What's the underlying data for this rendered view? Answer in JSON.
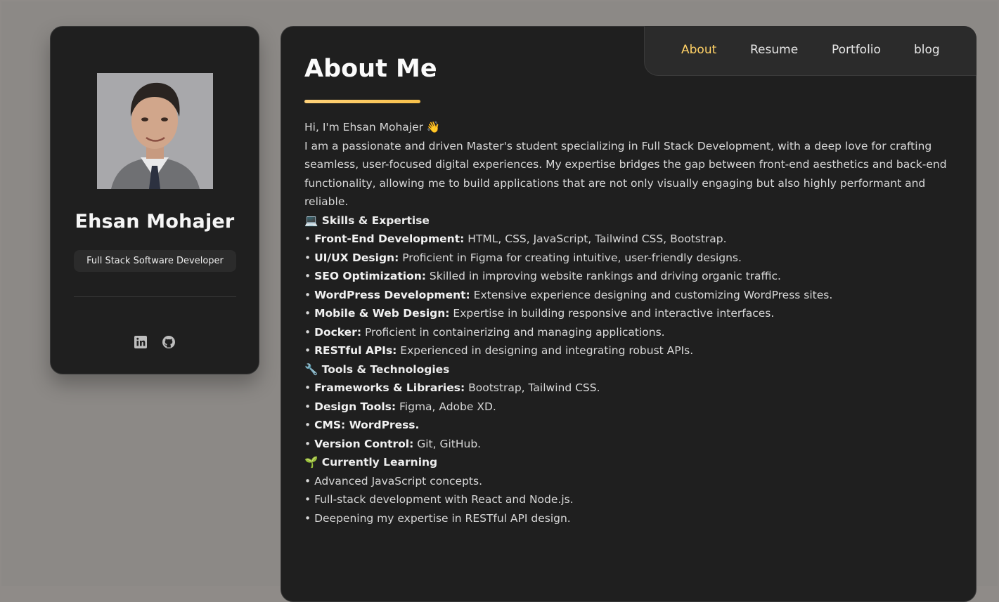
{
  "profile": {
    "name": "Ehsan Mohajer",
    "title": "Full Stack Software Developer",
    "social_icons": [
      "linkedin-icon",
      "github-icon"
    ]
  },
  "nav": {
    "items": [
      {
        "label": "About",
        "active": true
      },
      {
        "label": "Resume",
        "active": false
      },
      {
        "label": "Portfolio",
        "active": false
      },
      {
        "label": "blog",
        "active": false
      }
    ]
  },
  "about": {
    "title": "About Me",
    "greeting": "Hi, I'm Ehsan Mohajer 👋",
    "intro": "I am a passionate and driven Master's student specializing in Full Stack Development, with a deep love for crafting seamless, user-focused digital experiences. My expertise bridges the gap between front-end aesthetics and back-end functionality, allowing me to build applications that are not only visually engaging but also highly performant and reliable.",
    "sections": [
      {
        "heading": "💻 Skills & Expertise",
        "items": [
          {
            "label": "Front-End Development:",
            "text": " HTML, CSS, JavaScript, Tailwind CSS, Bootstrap."
          },
          {
            "label": "UI/UX Design:",
            "text": " Proficient in Figma for creating intuitive, user-friendly designs."
          },
          {
            "label": "SEO Optimization:",
            "text": " Skilled in improving website rankings and driving organic traffic."
          },
          {
            "label": "WordPress Development:",
            "text": " Extensive experience designing and customizing WordPress sites."
          },
          {
            "label": "Mobile & Web Design:",
            "text": " Expertise in building responsive and interactive interfaces."
          },
          {
            "label": "Docker:",
            "text": " Proficient in containerizing and managing applications."
          },
          {
            "label": "RESTful APIs:",
            "text": " Experienced in designing and integrating robust APIs."
          }
        ]
      },
      {
        "heading": "🔧 Tools & Technologies",
        "items": [
          {
            "label": "Frameworks & Libraries:",
            "text": " Bootstrap, Tailwind CSS."
          },
          {
            "label": "Design Tools:",
            "text": " Figma, Adobe XD."
          },
          {
            "label": "CMS: WordPress.",
            "text": ""
          },
          {
            "label": "Version Control:",
            "text": " Git, GitHub."
          }
        ]
      },
      {
        "heading": "🌱 Currently Learning",
        "items": [
          {
            "label": "",
            "text": "Advanced JavaScript concepts."
          },
          {
            "label": "",
            "text": "Full-stack development with React and Node.js."
          },
          {
            "label": "",
            "text": "Deepening my expertise in RESTful API design."
          }
        ]
      }
    ]
  },
  "colors": {
    "accent": "#ffd166",
    "card_bg": "#1f1f1f",
    "page_bg": "#8c8986"
  }
}
